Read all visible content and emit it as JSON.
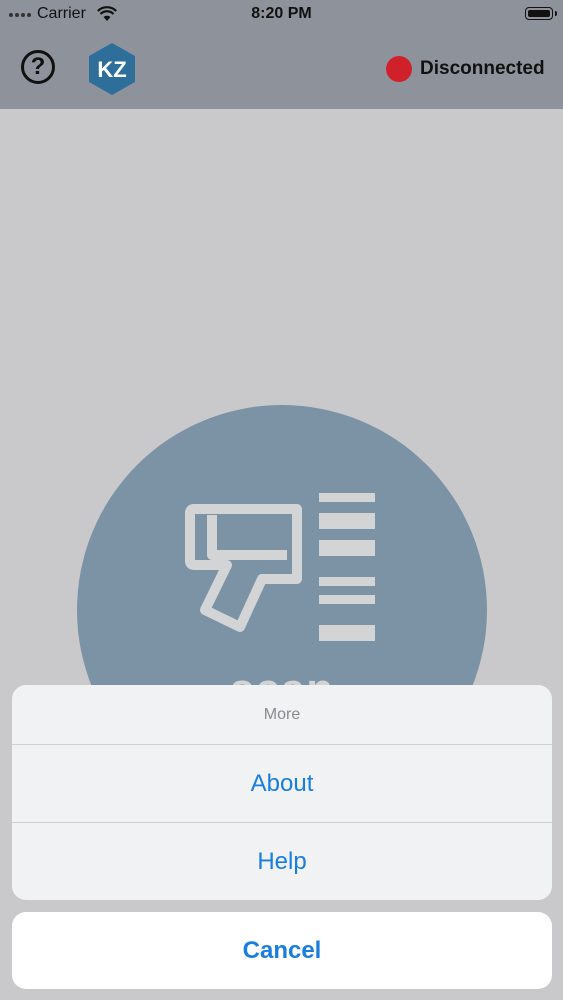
{
  "status_bar": {
    "carrier": "Carrier",
    "time": "8:20 PM",
    "wifi_icon": "wifi-icon",
    "battery_icon": "battery-icon"
  },
  "nav_bar": {
    "help_label": "?",
    "logo_text": "KZ",
    "connection_status": "Disconnected",
    "status_color": "#d0202a"
  },
  "scan": {
    "label": "scan",
    "icon": "barcode-scanner-icon"
  },
  "action_sheet": {
    "title": "More",
    "items": [
      {
        "label": "About"
      },
      {
        "label": "Help"
      }
    ],
    "cancel_label": "Cancel"
  },
  "colors": {
    "accent": "#1a7ee0",
    "header": "#8e939b",
    "scan_circle": "#7b93a5"
  }
}
